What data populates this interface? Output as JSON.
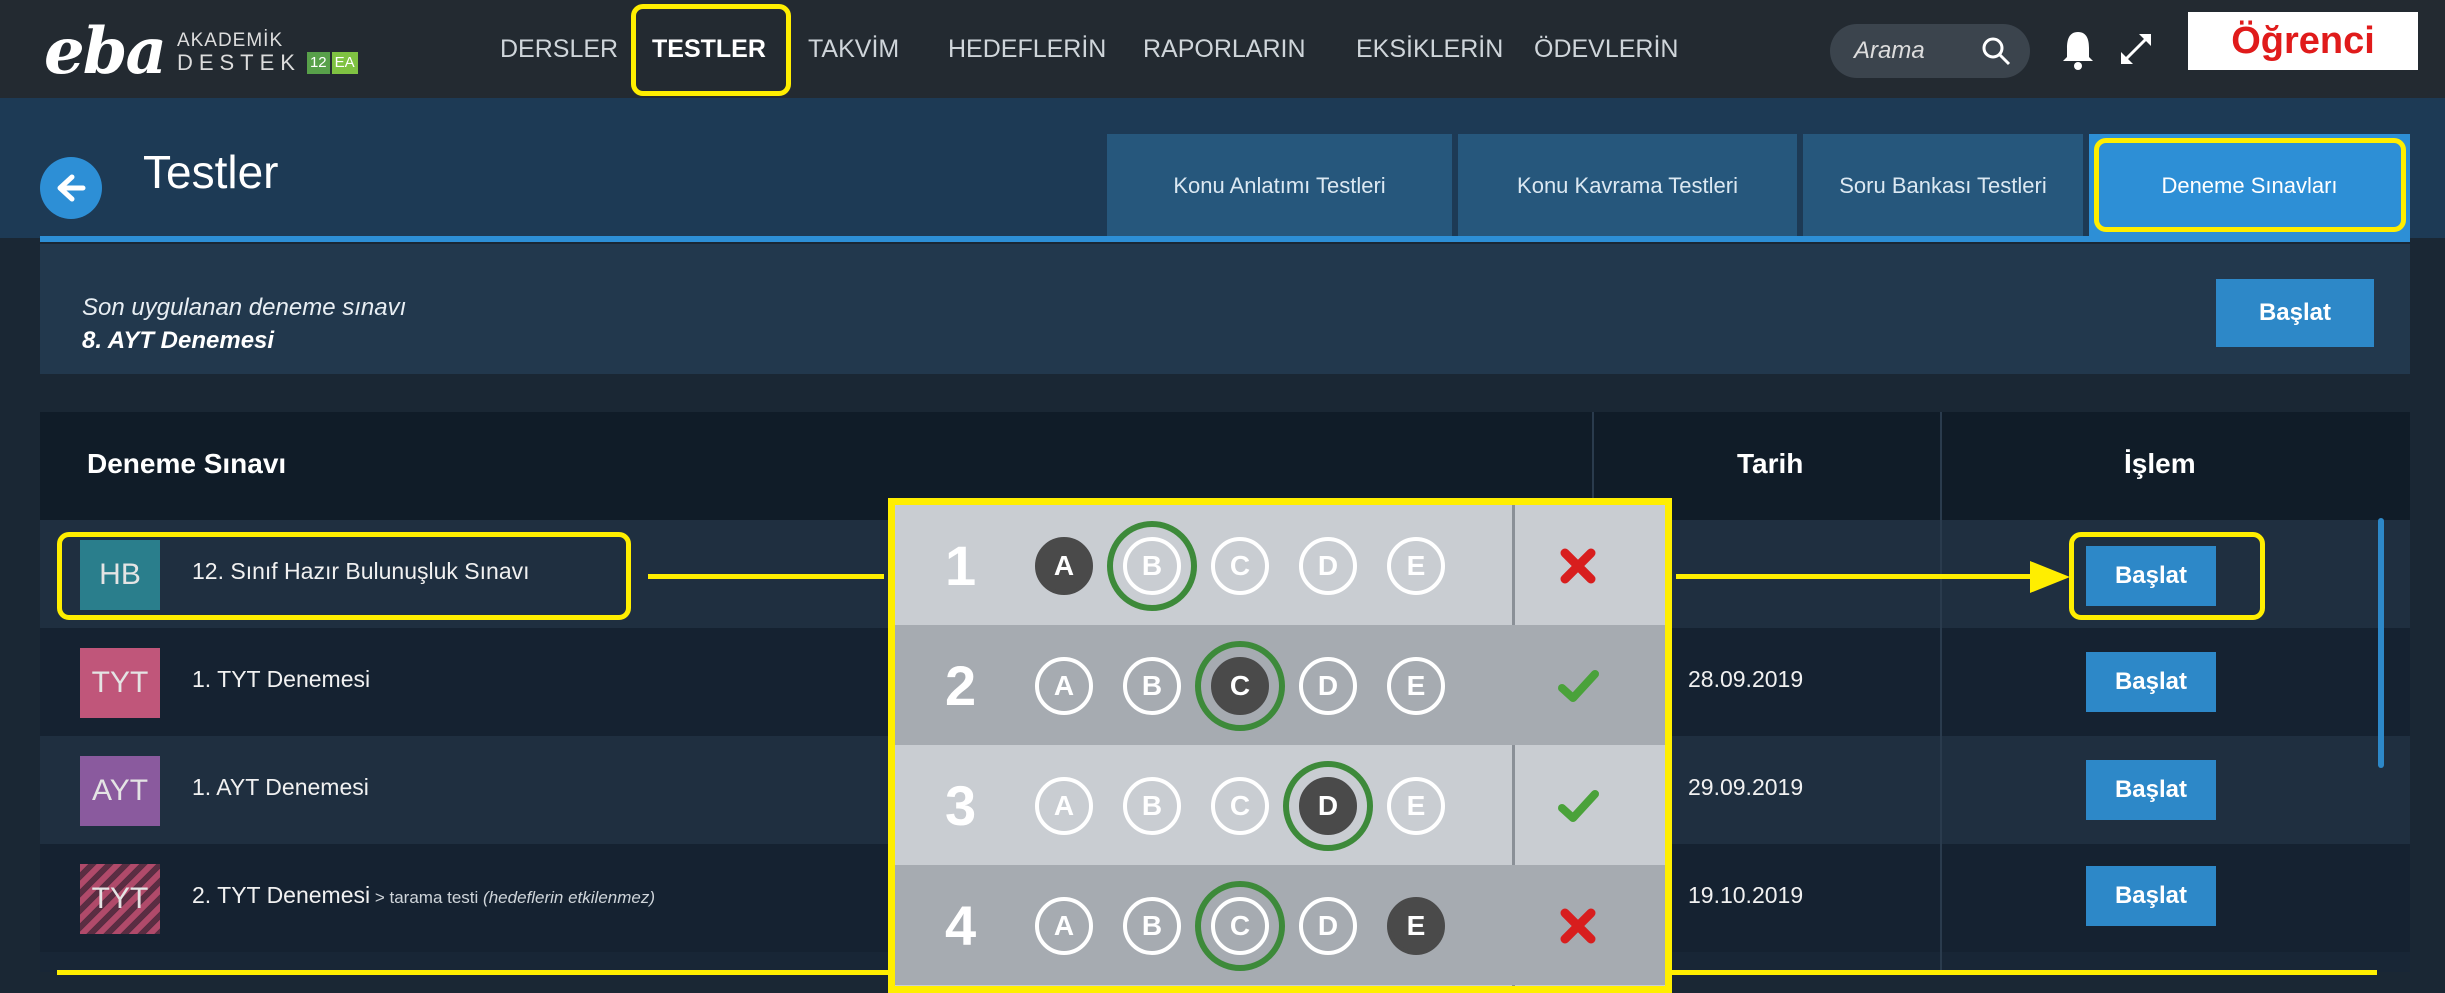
{
  "logo": {
    "brand": "eba",
    "line1": "AKADEMİK",
    "line2": "DESTEK",
    "badge_grade": "12",
    "badge_track": "EA"
  },
  "nav": {
    "items": [
      "DERSLER",
      "TESTLER",
      "TAKVİM",
      "HEDEFLERİN",
      "RAPORLARIN",
      "EKSİKLERİN",
      "ÖDEVLERİN"
    ],
    "active": "TESTLER"
  },
  "search": {
    "placeholder": "Arama"
  },
  "role_label": "Öğrenci",
  "page": {
    "title": "Testler"
  },
  "tabs": [
    "Konu Anlatımı Testleri",
    "Konu Kavrama Testleri",
    "Soru Bankası Testleri",
    "Deneme Sınavları"
  ],
  "selected_tab": "Deneme Sınavları",
  "last_exam": {
    "label": "Son uygulanan deneme sınavı",
    "name": "8. AYT Denemesi",
    "button": "Başlat"
  },
  "table": {
    "headers": [
      "Deneme Sınavı",
      "Tarih",
      "İşlem"
    ],
    "rows": [
      {
        "tag": "HB",
        "tag_color": "#2a7e8c",
        "name": "12. Sınıf Hazır Bulunuşluk Sınavı",
        "suffix": "",
        "note": "",
        "date": "",
        "action": "Başlat"
      },
      {
        "tag": "TYT",
        "tag_color": "#c0567a",
        "name": "1. TYT Denemesi",
        "suffix": "",
        "note": "",
        "date": "28.09.2019",
        "action": "Başlat"
      },
      {
        "tag": "AYT",
        "tag_color": "#8a5a9e",
        "name": "1. AYT Denemesi",
        "suffix": "",
        "note": "",
        "date": "29.09.2019",
        "action": "Başlat"
      },
      {
        "tag": "TYT",
        "tag_color": "#b04a6a",
        "name": "2. TYT Denemesi",
        "suffix": " > tarama testi ",
        "note": "(hedeflerin etkilenmez)",
        "date": "19.10.2019",
        "action": "Başlat"
      }
    ]
  },
  "answer_sheet": {
    "options": [
      "A",
      "B",
      "C",
      "D",
      "E"
    ],
    "questions": [
      {
        "number": "1",
        "marked": "A",
        "correct": "B",
        "result": "wrong"
      },
      {
        "number": "2",
        "marked": "C",
        "correct": "C",
        "result": "correct"
      },
      {
        "number": "3",
        "marked": "D",
        "correct": "D",
        "result": "correct"
      },
      {
        "number": "4",
        "marked": "E",
        "correct": "C",
        "result": "wrong"
      }
    ]
  },
  "colors": {
    "accent": "#2d88c8",
    "highlight": "#ffee00",
    "wrong": "#d81e1e",
    "correct": "#4aa23a"
  }
}
